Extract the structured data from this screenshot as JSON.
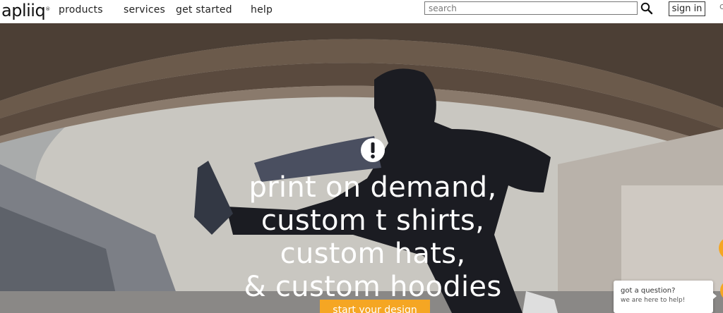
{
  "brand": {
    "logo_text": "apliiq",
    "logo_mark": "®"
  },
  "nav": {
    "products": "products",
    "services": "services",
    "get_started": "get started",
    "help": "help"
  },
  "search": {
    "placeholder": "search",
    "value": ""
  },
  "account": {
    "sign_in": "sign in",
    "edge_glyph": "c"
  },
  "hero": {
    "icon": "exclamation-icon",
    "headline": [
      "print on demand,",
      "custom t shirts,",
      "custom hats,",
      "& custom hoodies"
    ],
    "cta": "start your design"
  },
  "chat": {
    "title": "got a question?",
    "subtitle": "we are here to help!"
  },
  "colors": {
    "accent": "#f5a623",
    "nav_bg": "#ffffff",
    "text": "#222222"
  }
}
